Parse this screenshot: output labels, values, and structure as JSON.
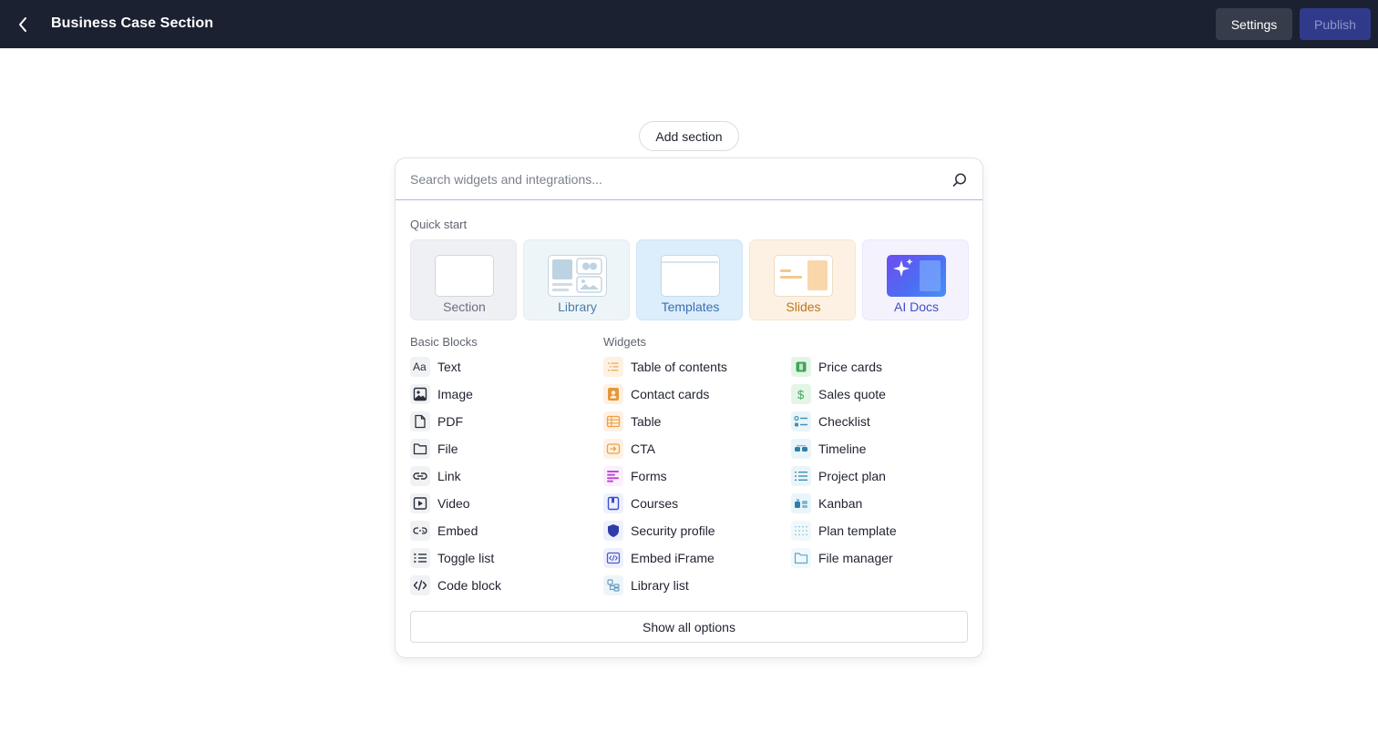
{
  "header": {
    "title": "Business Case Section",
    "settings_label": "Settings",
    "publish_label": "Publish"
  },
  "add_section_label": "Add section",
  "search": {
    "placeholder": "Search widgets and integrations..."
  },
  "quick_start": {
    "heading": "Quick start",
    "cards": [
      {
        "label": "Section",
        "color": "#6b7080"
      },
      {
        "label": "Library",
        "color": "#4e7da6"
      },
      {
        "label": "Templates",
        "color": "#3d6fb0"
      },
      {
        "label": "Slides",
        "color": "#b7791f"
      },
      {
        "label": "AI Docs",
        "color": "#3f51c4"
      }
    ]
  },
  "basic_blocks": {
    "heading": "Basic Blocks",
    "items": [
      {
        "label": "Text",
        "icon": "text-icon"
      },
      {
        "label": "Image",
        "icon": "image-icon"
      },
      {
        "label": "PDF",
        "icon": "pdf-icon"
      },
      {
        "label": "File",
        "icon": "folder-icon"
      },
      {
        "label": "Link",
        "icon": "link-icon"
      },
      {
        "label": "Video",
        "icon": "video-icon"
      },
      {
        "label": "Embed",
        "icon": "embed-icon"
      },
      {
        "label": "Toggle list",
        "icon": "toggle-list-icon"
      },
      {
        "label": "Code block",
        "icon": "code-icon"
      }
    ]
  },
  "widgets": {
    "heading": "Widgets",
    "column1": [
      {
        "label": "Table of contents",
        "icon": "table-of-contents-icon"
      },
      {
        "label": "Contact cards",
        "icon": "contact-card-icon"
      },
      {
        "label": "Table",
        "icon": "table-icon"
      },
      {
        "label": "CTA",
        "icon": "cta-icon"
      },
      {
        "label": "Forms",
        "icon": "forms-icon"
      },
      {
        "label": "Courses",
        "icon": "courses-icon"
      },
      {
        "label": "Security profile",
        "icon": "shield-icon"
      },
      {
        "label": "Embed iFrame",
        "icon": "iframe-icon"
      },
      {
        "label": "Library list",
        "icon": "library-list-icon"
      }
    ],
    "column2": [
      {
        "label": "Price cards",
        "icon": "price-card-icon"
      },
      {
        "label": "Sales quote",
        "icon": "dollar-icon"
      },
      {
        "label": "Checklist",
        "icon": "checklist-icon"
      },
      {
        "label": "Timeline",
        "icon": "timeline-icon"
      },
      {
        "label": "Project plan",
        "icon": "project-plan-icon"
      },
      {
        "label": "Kanban",
        "icon": "kanban-icon"
      },
      {
        "label": "Plan template",
        "icon": "plan-template-icon"
      },
      {
        "label": "File manager",
        "icon": "file-manager-icon"
      }
    ]
  },
  "show_all_label": "Show all options",
  "colors": {
    "topbar": "#1b2130",
    "publish": "#2f3b8a",
    "settings": "#363c49",
    "search_focus": "#aeb6ec"
  }
}
